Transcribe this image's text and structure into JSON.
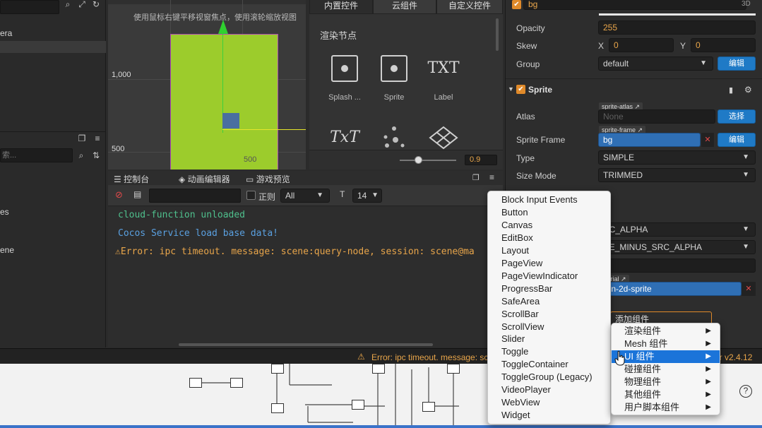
{
  "left_panel": {
    "hierarchy_items": [
      "era"
    ],
    "assets_search_placeholder": "索...",
    "assets_items": [
      "es",
      "ene"
    ]
  },
  "scene_view": {
    "hint": "使用鼠标右键平移视窗焦点，使用滚轮缩放视图",
    "ruler_y_1000": "1,000",
    "ruler_y_500": "500",
    "ruler_x_500": "500"
  },
  "node_library": {
    "tabs": [
      "内置控件",
      "云组件",
      "自定义控件"
    ],
    "section_title": "渲染节点",
    "items": [
      {
        "label": "Splash ...",
        "icon": "image-box-icon"
      },
      {
        "label": "Sprite",
        "icon": "image-box-icon"
      },
      {
        "label": "Label",
        "glyph": "TXT"
      },
      {
        "label": "",
        "glyph": "TxT"
      },
      {
        "label": "",
        "icon": "particle-icon"
      },
      {
        "label": "",
        "icon": "tiledmap-icon"
      }
    ],
    "zoom_value": "0.9"
  },
  "console": {
    "tabs": [
      "控制台",
      "动画编辑器",
      "游戏预览"
    ],
    "regex_label": "正则",
    "level_filter": "All",
    "font_size": "14",
    "lines": [
      {
        "text": "cloud-function unloaded",
        "color": "#4fc08d"
      },
      {
        "text": "Cocos Service load base data!",
        "color": "#5aa0e0"
      },
      {
        "text": "Error: ipc timeout. message: scene:query-node, session: scene@ma",
        "color": "#e8a54a"
      }
    ]
  },
  "inspector": {
    "node_name": "bg",
    "badge_3d": "3D",
    "opacity_label": "Opacity",
    "opacity_value": "255",
    "skew_label": "Skew",
    "skew_x_label": "X",
    "skew_x": "0",
    "skew_y_label": "Y",
    "skew_y": "0",
    "group_label": "Group",
    "group_value": "default",
    "edit_label": "编辑",
    "sprite_title": "Sprite",
    "atlas_label": "Atlas",
    "atlas_tag": "sprite-atlas",
    "atlas_value": "None",
    "select_label": "选择",
    "sprite_frame_label": "Sprite Frame",
    "sprite_frame_tag": "sprite-frame",
    "sprite_frame_value": "bg",
    "type_label": "Type",
    "type_value": "SIMPLE",
    "size_mode_label": "Size Mode",
    "size_mode_value": "TRIMMED",
    "src_blend": "RC_ALPHA",
    "dst_blend": "NE_MINUS_SRC_ALPHA",
    "material_tag": "aterial",
    "material_value": "iltin-2d-sprite",
    "add_component": "添加组件"
  },
  "status_bar": {
    "error_text": "Error: ipc timeout. message: sc",
    "version": "or v2.4.12"
  },
  "component_menu": {
    "items": [
      {
        "label": "渲染组件",
        "highlighted": false
      },
      {
        "label": "Mesh 组件",
        "highlighted": false
      },
      {
        "label": "UI 组件",
        "highlighted": true
      },
      {
        "label": "碰撞组件",
        "highlighted": false
      },
      {
        "label": "物理组件",
        "highlighted": false
      },
      {
        "label": "其他组件",
        "highlighted": false
      },
      {
        "label": "用户脚本组件",
        "highlighted": false
      }
    ]
  },
  "ui_submenu": {
    "items": [
      "Block Input Events",
      "Button",
      "Canvas",
      "EditBox",
      "Layout",
      "PageView",
      "PageViewIndicator",
      "ProgressBar",
      "SafeArea",
      "ScrollBar",
      "ScrollView",
      "Slider",
      "Toggle",
      "ToggleContainer",
      "ToggleGroup (Legacy)",
      "VideoPlayer",
      "WebView",
      "Widget"
    ]
  },
  "colors": {
    "accent_blue": "#1f7ac6",
    "menu_highlight": "#1b74d9",
    "value_orange": "#e8a54a",
    "success_green": "#4fc08d"
  }
}
